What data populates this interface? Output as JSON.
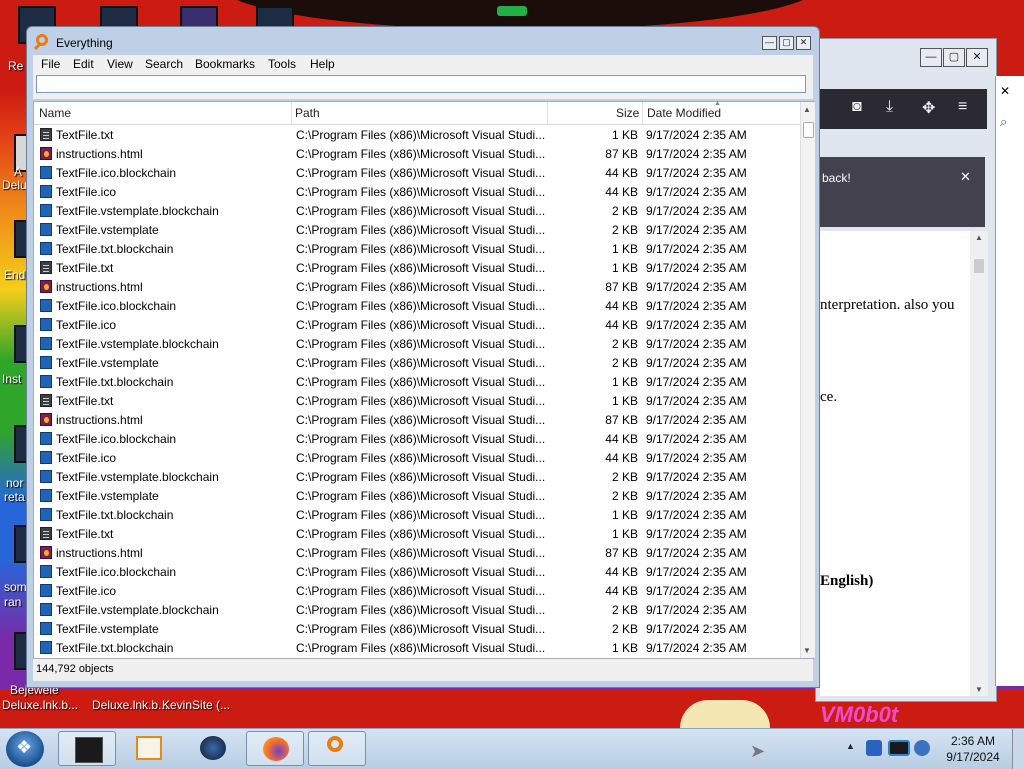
{
  "desktop": {
    "labels": [
      "Re",
      "A",
      "Delu",
      "End",
      "Inst",
      "nor",
      "reta",
      "som",
      "ran",
      "Bejewele",
      "Deluxe.lnk.b...",
      "Deluxe.lnk.b...",
      "KevinSite (..."
    ],
    "watermark": "VM0b0t"
  },
  "firefox": {
    "notification": "back!",
    "notification_close": "✕",
    "content_lines": [
      "nterpretation. also you",
      "ce.",
      "English)"
    ],
    "controls": {
      "minimize": "—",
      "maximize": "▢",
      "close": "✕"
    }
  },
  "window": {
    "title": "Everything",
    "controls": {
      "minimize": "—",
      "maximize": "▢",
      "close": "✕"
    }
  },
  "menu": [
    "File",
    "Edit",
    "View",
    "Search",
    "Bookmarks",
    "Tools",
    "Help"
  ],
  "search": {
    "value": "",
    "placeholder": ""
  },
  "columns": {
    "name": "Name",
    "path": "Path",
    "size": "Size",
    "date": "Date Modified"
  },
  "rows": [
    {
      "icon": "text-file-icon",
      "name": "TextFile.txt",
      "path": "C:\\Program Files (x86)\\Microsoft Visual Studi...",
      "size": "1 KB",
      "date": "9/17/2024 2:35 AM"
    },
    {
      "icon": "html-file-icon",
      "name": "instructions.html",
      "path": "C:\\Program Files (x86)\\Microsoft Visual Studi...",
      "size": "87 KB",
      "date": "9/17/2024 2:35 AM"
    },
    {
      "icon": "blockchain-file-icon",
      "name": "TextFile.ico.blockchain",
      "path": "C:\\Program Files (x86)\\Microsoft Visual Studi...",
      "size": "44 KB",
      "date": "9/17/2024 2:35 AM"
    },
    {
      "icon": "blockchain-file-icon",
      "name": "TextFile.ico",
      "path": "C:\\Program Files (x86)\\Microsoft Visual Studi...",
      "size": "44 KB",
      "date": "9/17/2024 2:35 AM"
    },
    {
      "icon": "blockchain-file-icon",
      "name": "TextFile.vstemplate.blockchain",
      "path": "C:\\Program Files (x86)\\Microsoft Visual Studi...",
      "size": "2 KB",
      "date": "9/17/2024 2:35 AM"
    },
    {
      "icon": "blockchain-file-icon",
      "name": "TextFile.vstemplate",
      "path": "C:\\Program Files (x86)\\Microsoft Visual Studi...",
      "size": "2 KB",
      "date": "9/17/2024 2:35 AM"
    },
    {
      "icon": "blockchain-file-icon",
      "name": "TextFile.txt.blockchain",
      "path": "C:\\Program Files (x86)\\Microsoft Visual Studi...",
      "size": "1 KB",
      "date": "9/17/2024 2:35 AM"
    },
    {
      "icon": "text-file-icon",
      "name": "TextFile.txt",
      "path": "C:\\Program Files (x86)\\Microsoft Visual Studi...",
      "size": "1 KB",
      "date": "9/17/2024 2:35 AM"
    },
    {
      "icon": "html-file-icon",
      "name": "instructions.html",
      "path": "C:\\Program Files (x86)\\Microsoft Visual Studi...",
      "size": "87 KB",
      "date": "9/17/2024 2:35 AM"
    },
    {
      "icon": "blockchain-file-icon",
      "name": "TextFile.ico.blockchain",
      "path": "C:\\Program Files (x86)\\Microsoft Visual Studi...",
      "size": "44 KB",
      "date": "9/17/2024 2:35 AM"
    },
    {
      "icon": "blockchain-file-icon",
      "name": "TextFile.ico",
      "path": "C:\\Program Files (x86)\\Microsoft Visual Studi...",
      "size": "44 KB",
      "date": "9/17/2024 2:35 AM"
    },
    {
      "icon": "blockchain-file-icon",
      "name": "TextFile.vstemplate.blockchain",
      "path": "C:\\Program Files (x86)\\Microsoft Visual Studi...",
      "size": "2 KB",
      "date": "9/17/2024 2:35 AM"
    },
    {
      "icon": "blockchain-file-icon",
      "name": "TextFile.vstemplate",
      "path": "C:\\Program Files (x86)\\Microsoft Visual Studi...",
      "size": "2 KB",
      "date": "9/17/2024 2:35 AM"
    },
    {
      "icon": "blockchain-file-icon",
      "name": "TextFile.txt.blockchain",
      "path": "C:\\Program Files (x86)\\Microsoft Visual Studi...",
      "size": "1 KB",
      "date": "9/17/2024 2:35 AM"
    },
    {
      "icon": "text-file-icon",
      "name": "TextFile.txt",
      "path": "C:\\Program Files (x86)\\Microsoft Visual Studi...",
      "size": "1 KB",
      "date": "9/17/2024 2:35 AM"
    },
    {
      "icon": "html-file-icon",
      "name": "instructions.html",
      "path": "C:\\Program Files (x86)\\Microsoft Visual Studi...",
      "size": "87 KB",
      "date": "9/17/2024 2:35 AM"
    },
    {
      "icon": "blockchain-file-icon",
      "name": "TextFile.ico.blockchain",
      "path": "C:\\Program Files (x86)\\Microsoft Visual Studi...",
      "size": "44 KB",
      "date": "9/17/2024 2:35 AM"
    },
    {
      "icon": "blockchain-file-icon",
      "name": "TextFile.ico",
      "path": "C:\\Program Files (x86)\\Microsoft Visual Studi...",
      "size": "44 KB",
      "date": "9/17/2024 2:35 AM"
    },
    {
      "icon": "blockchain-file-icon",
      "name": "TextFile.vstemplate.blockchain",
      "path": "C:\\Program Files (x86)\\Microsoft Visual Studi...",
      "size": "2 KB",
      "date": "9/17/2024 2:35 AM"
    },
    {
      "icon": "blockchain-file-icon",
      "name": "TextFile.vstemplate",
      "path": "C:\\Program Files (x86)\\Microsoft Visual Studi...",
      "size": "2 KB",
      "date": "9/17/2024 2:35 AM"
    },
    {
      "icon": "blockchain-file-icon",
      "name": "TextFile.txt.blockchain",
      "path": "C:\\Program Files (x86)\\Microsoft Visual Studi...",
      "size": "1 KB",
      "date": "9/17/2024 2:35 AM"
    },
    {
      "icon": "text-file-icon",
      "name": "TextFile.txt",
      "path": "C:\\Program Files (x86)\\Microsoft Visual Studi...",
      "size": "1 KB",
      "date": "9/17/2024 2:35 AM"
    },
    {
      "icon": "html-file-icon",
      "name": "instructions.html",
      "path": "C:\\Program Files (x86)\\Microsoft Visual Studi...",
      "size": "87 KB",
      "date": "9/17/2024 2:35 AM"
    },
    {
      "icon": "blockchain-file-icon",
      "name": "TextFile.ico.blockchain",
      "path": "C:\\Program Files (x86)\\Microsoft Visual Studi...",
      "size": "44 KB",
      "date": "9/17/2024 2:35 AM"
    },
    {
      "icon": "blockchain-file-icon",
      "name": "TextFile.ico",
      "path": "C:\\Program Files (x86)\\Microsoft Visual Studi...",
      "size": "44 KB",
      "date": "9/17/2024 2:35 AM"
    },
    {
      "icon": "blockchain-file-icon",
      "name": "TextFile.vstemplate.blockchain",
      "path": "C:\\Program Files (x86)\\Microsoft Visual Studi...",
      "size": "2 KB",
      "date": "9/17/2024 2:35 AM"
    },
    {
      "icon": "blockchain-file-icon",
      "name": "TextFile.vstemplate",
      "path": "C:\\Program Files (x86)\\Microsoft Visual Studi...",
      "size": "2 KB",
      "date": "9/17/2024 2:35 AM"
    },
    {
      "icon": "blockchain-file-icon",
      "name": "TextFile.txt.blockchain",
      "path": "C:\\Program Files (x86)\\Microsoft Visual Studi...",
      "size": "1 KB",
      "date": "9/17/2024 2:35 AM"
    }
  ],
  "status": {
    "text": "144,792 objects"
  },
  "taskbar": {
    "apps": [
      {
        "name": "taskbar-app-terminal",
        "icon": "black-window-icon"
      },
      {
        "name": "taskbar-app-media",
        "icon": "media-player-icon"
      },
      {
        "name": "taskbar-app-globe",
        "icon": "globe-icon"
      },
      {
        "name": "taskbar-app-firefox",
        "icon": "firefox-icon"
      },
      {
        "name": "taskbar-app-everything",
        "icon": "magnifier-icon"
      }
    ],
    "clock": {
      "time": "2:36 AM",
      "date": "9/17/2024"
    }
  },
  "colors": {
    "accent": "#e87d12",
    "titlebar": "#bfd0e6",
    "blockchain_icon": "#1f64b5"
  }
}
